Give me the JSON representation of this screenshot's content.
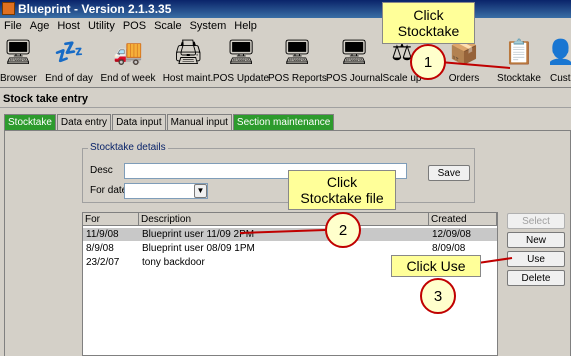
{
  "window": {
    "title": "Blueprint - Version 2.1.3.35"
  },
  "menu": [
    "File",
    "Age",
    "Host",
    "Utility",
    "POS",
    "Scale",
    "System",
    "Help"
  ],
  "toolbar": [
    {
      "label": "Browser",
      "icon": "browser-icon",
      "glyph": "🖥"
    },
    {
      "label": "End of day",
      "icon": "end-of-day-icon",
      "glyph": "💤"
    },
    {
      "label": "End of week",
      "icon": "end-of-week-icon",
      "glyph": "🚚"
    },
    {
      "label": "Host maint.",
      "icon": "host-maint-icon",
      "glyph": "🖨"
    },
    {
      "label": "POS Update",
      "icon": "pos-update-icon",
      "glyph": "🖥"
    },
    {
      "label": "POS Reports",
      "icon": "pos-reports-icon",
      "glyph": "🖥"
    },
    {
      "label": "POS Journal",
      "icon": "pos-journal-icon",
      "glyph": "🖥"
    },
    {
      "label": "Scale up",
      "icon": "scale-up-icon",
      "glyph": "⚖"
    },
    {
      "label": "Orders",
      "icon": "orders-icon",
      "glyph": "📦"
    },
    {
      "label": "Stocktake",
      "icon": "stocktake-icon",
      "glyph": "📋"
    },
    {
      "label": "Cust",
      "icon": "customers-icon",
      "glyph": "👤"
    }
  ],
  "section_title": "Stock take entry",
  "tabs": [
    {
      "label": "Stocktake",
      "green": true
    },
    {
      "label": "Data entry",
      "green": false
    },
    {
      "label": "Data input",
      "green": false
    },
    {
      "label": "Manual input",
      "green": false
    },
    {
      "label": "Section maintenance",
      "green": true
    }
  ],
  "details": {
    "legend": "Stocktake details",
    "desc_label": "Desc",
    "desc_value": "",
    "date_label": "For date",
    "date_value": "",
    "save_label": "Save"
  },
  "list": {
    "columns": [
      "For",
      "Description",
      "Created"
    ],
    "rows": [
      {
        "for": "11/9/08",
        "description": "Blueprint user 11/09 2PM",
        "created": "12/09/08",
        "selected": true
      },
      {
        "for": "8/9/08",
        "description": "Blueprint user 08/09 1PM",
        "created": "8/09/08",
        "selected": false
      },
      {
        "for": "23/2/07",
        "description": "tony backdoor",
        "created": "",
        "selected": false
      }
    ]
  },
  "buttons": {
    "select": "Select",
    "new": "New",
    "use": "Use",
    "delete": "Delete"
  },
  "callouts": {
    "c1": "Click\nStocktake",
    "c2": "Click\nStocktake file",
    "c3": "Click Use",
    "n1": "1",
    "n2": "2",
    "n3": "3"
  }
}
